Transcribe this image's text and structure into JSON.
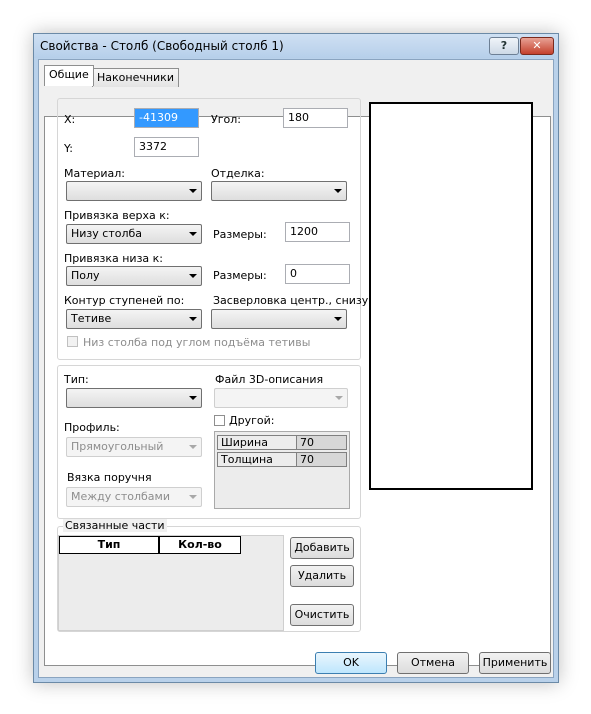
{
  "window": {
    "title": "Свойства - Столб  (Свободный столб 1)",
    "help_label": "?",
    "close_label": "✕"
  },
  "tabs": [
    {
      "label": "Общие",
      "active": true
    },
    {
      "label": "Наконечники",
      "active": false
    }
  ],
  "general": {
    "x_label": "X:",
    "x_value": "-41309",
    "angle_label": "Угол:",
    "angle_value": "180",
    "y_label": "Y:",
    "y_value": "3372",
    "material_label": "Материал:",
    "material_value": "",
    "finish_label": "Отделка:",
    "finish_value": "",
    "top_binding_label": "Привязка верха к:",
    "top_binding_value": "Низу столба",
    "top_size_label": "Размеры:",
    "top_size_value": "1200",
    "bottom_binding_label": "Привязка низа к:",
    "bottom_binding_value": "Полу",
    "bottom_size_label": "Размеры:",
    "bottom_size_value": "0",
    "step_contour_label": "Контур ступеней по:",
    "step_contour_value": "Тетиве",
    "center_drill_label": "Засверловка центр., снизу",
    "center_drill_value": "",
    "angle_bottom_label": "Низ столба под углом подъёма тетивы"
  },
  "type_group": {
    "type_label": "Тип:",
    "type_value": "",
    "file3d_label": "Файл 3D-описания",
    "file3d_value": "",
    "profile_label": "Профиль:",
    "profile_value": "Прямоугольный",
    "other_label": "Другой:",
    "rail_label": "Вязка поручня",
    "rail_value": "Между столбами",
    "params": [
      {
        "name": "Ширина",
        "value": "70"
      },
      {
        "name": "Толщина",
        "value": "70"
      }
    ]
  },
  "linked": {
    "title": "Связанные части",
    "columns": [
      "Тип",
      "Кол-во"
    ],
    "add_label": "Добавить",
    "delete_label": "Удалить",
    "clear_label": "Очистить"
  },
  "footer": {
    "ok_label": "OK",
    "cancel_label": "Отмена",
    "apply_label": "Применить"
  }
}
